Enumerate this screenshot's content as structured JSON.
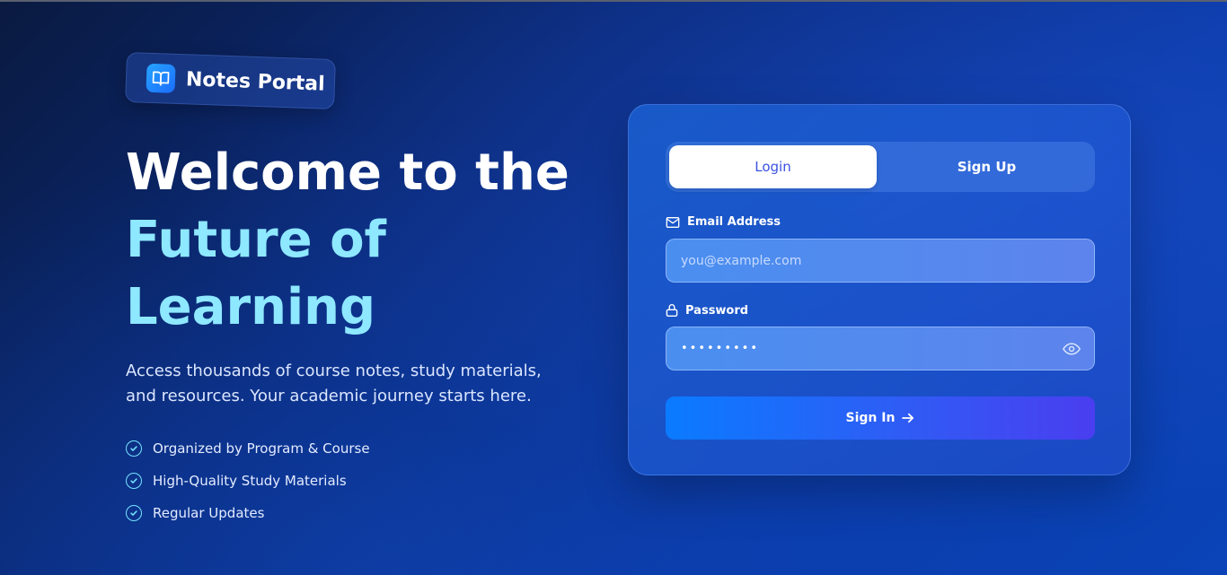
{
  "brand": {
    "name": "Notes Portal",
    "icon": "book-open-icon"
  },
  "hero": {
    "line1": "Welcome to the",
    "line2": "Future of",
    "line3": "Learning",
    "description": "Access thousands of course notes, study materials, and resources. Your academic journey starts here.",
    "features": [
      "Organized by Program & Course",
      "High-Quality Study Materials",
      "Regular Updates"
    ]
  },
  "auth": {
    "tabs": {
      "login": "Login",
      "signup": "Sign Up",
      "active": "Login"
    },
    "email": {
      "label": "Email Address",
      "placeholder": "you@example.com",
      "value": ""
    },
    "password": {
      "label": "Password",
      "value": "•••••••••"
    },
    "submit_label": "Sign In"
  },
  "colors": {
    "accent": "#8ee8ff",
    "tab_active_text": "#3a52e0",
    "button_start": "#0a7bff",
    "button_end": "#4a3ef0"
  }
}
